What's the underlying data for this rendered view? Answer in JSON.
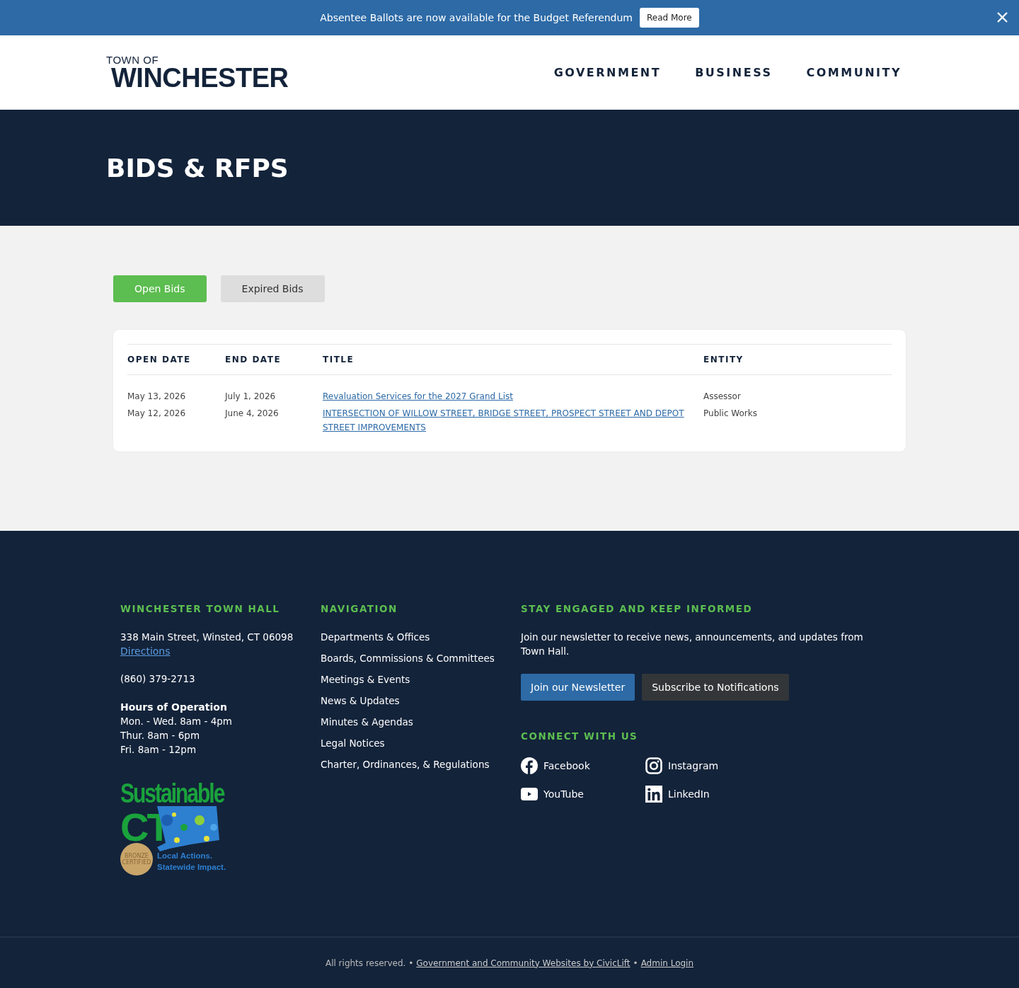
{
  "announcement": {
    "text": "Absentee Ballots are now available for the Budget Referendum",
    "button": "Read More"
  },
  "header": {
    "logo_small": "TOWN OF",
    "logo_large": "WINCHESTER",
    "nav": [
      "GOVERNMENT",
      "BUSINESS",
      "COMMUNITY"
    ]
  },
  "hero": {
    "title": "BIDS & RFPS"
  },
  "filters": [
    {
      "label": "Open Bids",
      "selected": true
    },
    {
      "label": "Expired Bids",
      "selected": false
    }
  ],
  "table": {
    "columns": [
      "OPEN DATE",
      "END DATE",
      "TITLE",
      "ENTITY"
    ],
    "rows": [
      {
        "open_date": "May 13, 2026",
        "end_date": "July 1, 2026",
        "title": "Revaluation Services for the 2027 Grand List",
        "entity": "Assessor"
      },
      {
        "open_date": "May 12, 2026",
        "end_date": "June 4, 2026",
        "title": "INTERSECTION OF WILLOW STREET, BRIDGE STREET, PROSPECT STREET AND DEPOT STREET IMPROVEMENTS",
        "entity": "Public Works"
      }
    ]
  },
  "footer": {
    "town_hall": {
      "heading": "WINCHESTER TOWN HALL",
      "address": "338 Main Street, Winsted, CT 06098",
      "directions": "Directions",
      "phone": "(860) 379-2713",
      "hours_heading": "Hours of Operation",
      "hours": [
        "Mon. - Wed. 8am - 4pm",
        "Thur. 8am - 6pm",
        "Fri. 8am - 12pm"
      ],
      "badge": {
        "title": "Sustainable",
        "state": "CT",
        "seal": "BRONZE CERTIFIED",
        "tagline_1": "Local Actions.",
        "tagline_2": "Statewide Impact."
      }
    },
    "navigation": {
      "heading": "NAVIGATION",
      "links": [
        "Departments & Offices",
        "Boards, Commissions & Committees",
        "Meetings & Events",
        "News & Updates",
        "Minutes & Agendas",
        "Legal Notices",
        "Charter, Ordinances, & Regulations"
      ]
    },
    "engage": {
      "heading": "STAY ENGAGED AND KEEP INFORMED",
      "text": "Join our newsletter to receive news, announcements, and updates from Town Hall.",
      "buttons": [
        {
          "label": "Join our Newsletter",
          "kind": "primary"
        },
        {
          "label": "Subscribe to Notifications",
          "kind": "secondary"
        }
      ],
      "connect_heading": "CONNECT WITH US",
      "social": [
        {
          "label": "Facebook",
          "kind": "facebook"
        },
        {
          "label": "Instagram",
          "kind": "instagram"
        },
        {
          "label": "YouTube",
          "kind": "youtube"
        },
        {
          "label": "LinkedIn",
          "kind": "linkedin"
        }
      ]
    }
  },
  "bottom": {
    "text": "All rights reserved. •",
    "credit_link": "Government and Community Websites by CivicLift",
    "separator": "•",
    "admin_link": "Admin Login"
  }
}
